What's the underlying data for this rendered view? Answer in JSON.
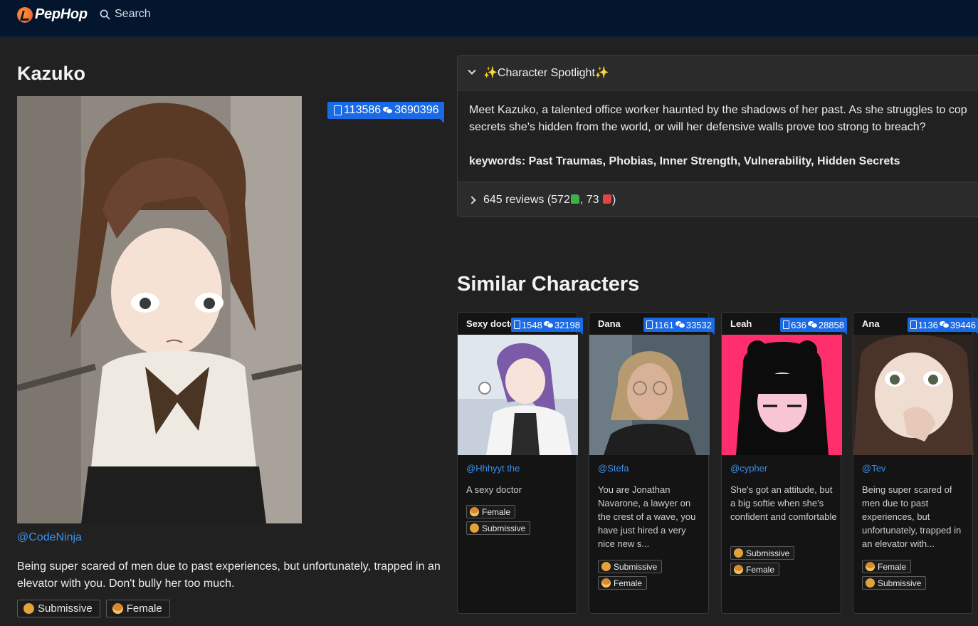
{
  "nav": {
    "brand": "PepHop",
    "search_label": "Search"
  },
  "character": {
    "name": "Kazuko",
    "stats": {
      "docs": "113586",
      "chats": "3690396"
    },
    "creator": "@CodeNinja",
    "description": "Being super scared of men due to past experiences, but unfortunately, trapped in an elevator with you. Don't bully her too much.",
    "tags": [
      "Submissive",
      "Female"
    ]
  },
  "spotlight": {
    "title": "✨Character Spotlight✨",
    "line1": "Meet Kazuko, a talented office worker haunted by the shadows of her past. As she struggles to cop",
    "line2": "secrets she's hidden from the world, or will her defensive walls prove too strong to breach?",
    "keywords": "keywords: Past Traumas, Phobias, Inner Strength, Vulnerability, Hidden Secrets",
    "reviews_prefix": "645 reviews (572",
    "reviews_mid": ", 73",
    "reviews_suffix": ")"
  },
  "similar": {
    "title": "Similar Characters",
    "cards": [
      {
        "name": "Sexy doctor",
        "docs": "1548",
        "chats": "32198",
        "creator": "@Hhhyyt the",
        "desc": "A sexy doctor",
        "tags": [
          "Female",
          "Submissive"
        ]
      },
      {
        "name": "Dana",
        "docs": "1161",
        "chats": "33532",
        "creator": "@Stefa",
        "desc": "You are Jonathan Navarone, a lawyer on the crest of a wave, you have just hired a very nice new s...",
        "tags": [
          "Submissive",
          "Female"
        ]
      },
      {
        "name": "Leah",
        "docs": "636",
        "chats": "28858",
        "creator": "@cypher",
        "desc": "She's got an attitude, but a big softie when she's confident and comfortable",
        "tags": [
          "Submissive",
          "Female"
        ]
      },
      {
        "name": "Ana",
        "docs": "1136",
        "chats": "39446",
        "creator": "@Tev",
        "desc": "Being super scared of men due to past experiences, but unfortunately, trapped in an elevator with...",
        "tags": [
          "Female",
          "Submissive"
        ]
      }
    ]
  },
  "colors": {
    "accent": "#1a6ae6",
    "link": "#3b8eea",
    "nav_bg": "#04162e",
    "page_bg": "#212121"
  }
}
